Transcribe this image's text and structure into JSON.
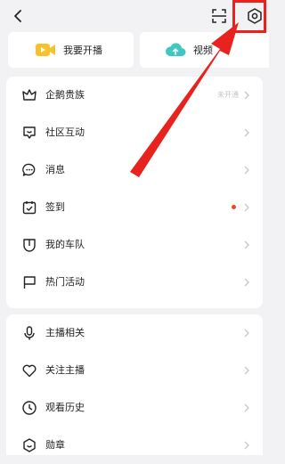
{
  "header": {
    "back_icon": "back-chevron-icon",
    "scan_icon": "scan-icon",
    "settings_icon": "gear-icon"
  },
  "actions": [
    {
      "label": "我要开播",
      "icon": "video-camera-icon",
      "icon_color": "#f5c22b"
    },
    {
      "label": "视频",
      "icon": "upload-cloud-icon",
      "icon_color": "#41c7c2"
    }
  ],
  "menu_group_1": [
    {
      "label": "企鹅贵族",
      "icon": "crown-icon",
      "status": "未开通"
    },
    {
      "label": "社区互动",
      "icon": "community-icon",
      "status": ""
    },
    {
      "label": "消息",
      "icon": "message-bubble-icon",
      "status": ""
    },
    {
      "label": "签到",
      "icon": "calendar-check-icon",
      "status": "",
      "dot": true
    },
    {
      "label": "我的车队",
      "icon": "shield-icon",
      "status": ""
    },
    {
      "label": "热门活动",
      "icon": "flag-icon",
      "status": ""
    }
  ],
  "menu_group_2": [
    {
      "label": "主播相关",
      "icon": "microphone-icon"
    },
    {
      "label": "关注主播",
      "icon": "heart-icon"
    },
    {
      "label": "观看历史",
      "icon": "clock-icon"
    },
    {
      "label": "勋章",
      "icon": "medal-icon"
    }
  ],
  "colors": {
    "background": "#f2f2f4",
    "annotation_red": "#e8231f",
    "notify_dot": "#e84a2c",
    "chevron": "#c8c8c8"
  }
}
